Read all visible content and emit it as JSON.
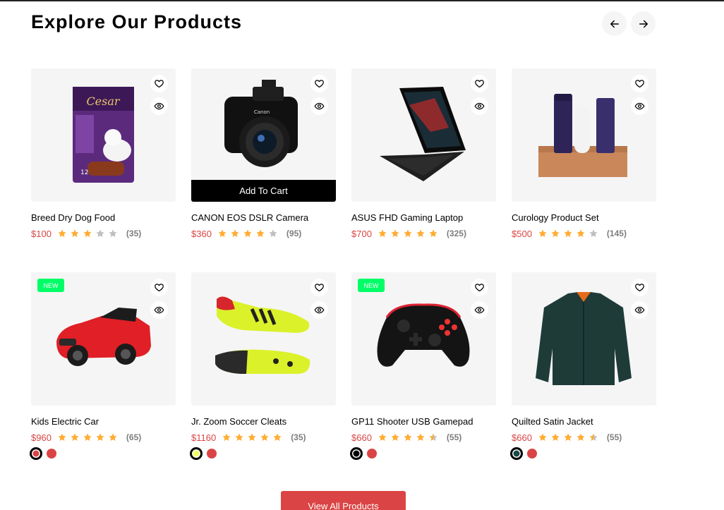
{
  "section": {
    "title": "Explore Our Products",
    "prev_icon": "arrow-left-icon",
    "next_icon": "arrow-right-icon"
  },
  "products": [
    {
      "name": "Breed Dry Dog Food",
      "price": "$100",
      "rating": 3,
      "count": "(35)",
      "badge": "",
      "add_to_cart": "",
      "colors": []
    },
    {
      "name": "CANON EOS DSLR Camera",
      "price": "$360",
      "rating": 4,
      "count": "(95)",
      "badge": "",
      "add_to_cart": "Add To Cart",
      "colors": []
    },
    {
      "name": "ASUS FHD Gaming Laptop",
      "price": "$700",
      "rating": 5,
      "count": "(325)",
      "badge": "",
      "add_to_cart": "",
      "colors": []
    },
    {
      "name": "Curology Product Set",
      "price": "$500",
      "rating": 4,
      "count": "(145)",
      "badge": "",
      "add_to_cart": "",
      "colors": []
    },
    {
      "name": "Kids Electric Car",
      "price": "$960",
      "rating": 5,
      "count": "(65)",
      "badge": "NEW",
      "add_to_cart": "",
      "colors": [
        "#db4444",
        "#db4444"
      ]
    },
    {
      "name": "Jr. Zoom Soccer Cleats",
      "price": "$1160",
      "rating": 5,
      "count": "(35)",
      "badge": "",
      "add_to_cart": "",
      "colors": [
        "#eeff61",
        "#db4444"
      ]
    },
    {
      "name": "GP11 Shooter USB Gamepad",
      "price": "$660",
      "rating": 4.5,
      "count": "(55)",
      "badge": "NEW",
      "add_to_cart": "",
      "colors": [
        "#000000",
        "#db4444"
      ]
    },
    {
      "name": "Quilted Satin Jacket",
      "price": "$660",
      "rating": 4.5,
      "count": "(55)",
      "badge": "",
      "add_to_cart": "",
      "colors": [
        "#184a48",
        "#db4444"
      ]
    }
  ],
  "view_all_label": "View All Products",
  "theme": {
    "accent": "#db4444",
    "star": "#ffad33",
    "star_empty": "#bfbfbf",
    "badge": "#00ff66",
    "card_bg": "#f5f5f5"
  }
}
